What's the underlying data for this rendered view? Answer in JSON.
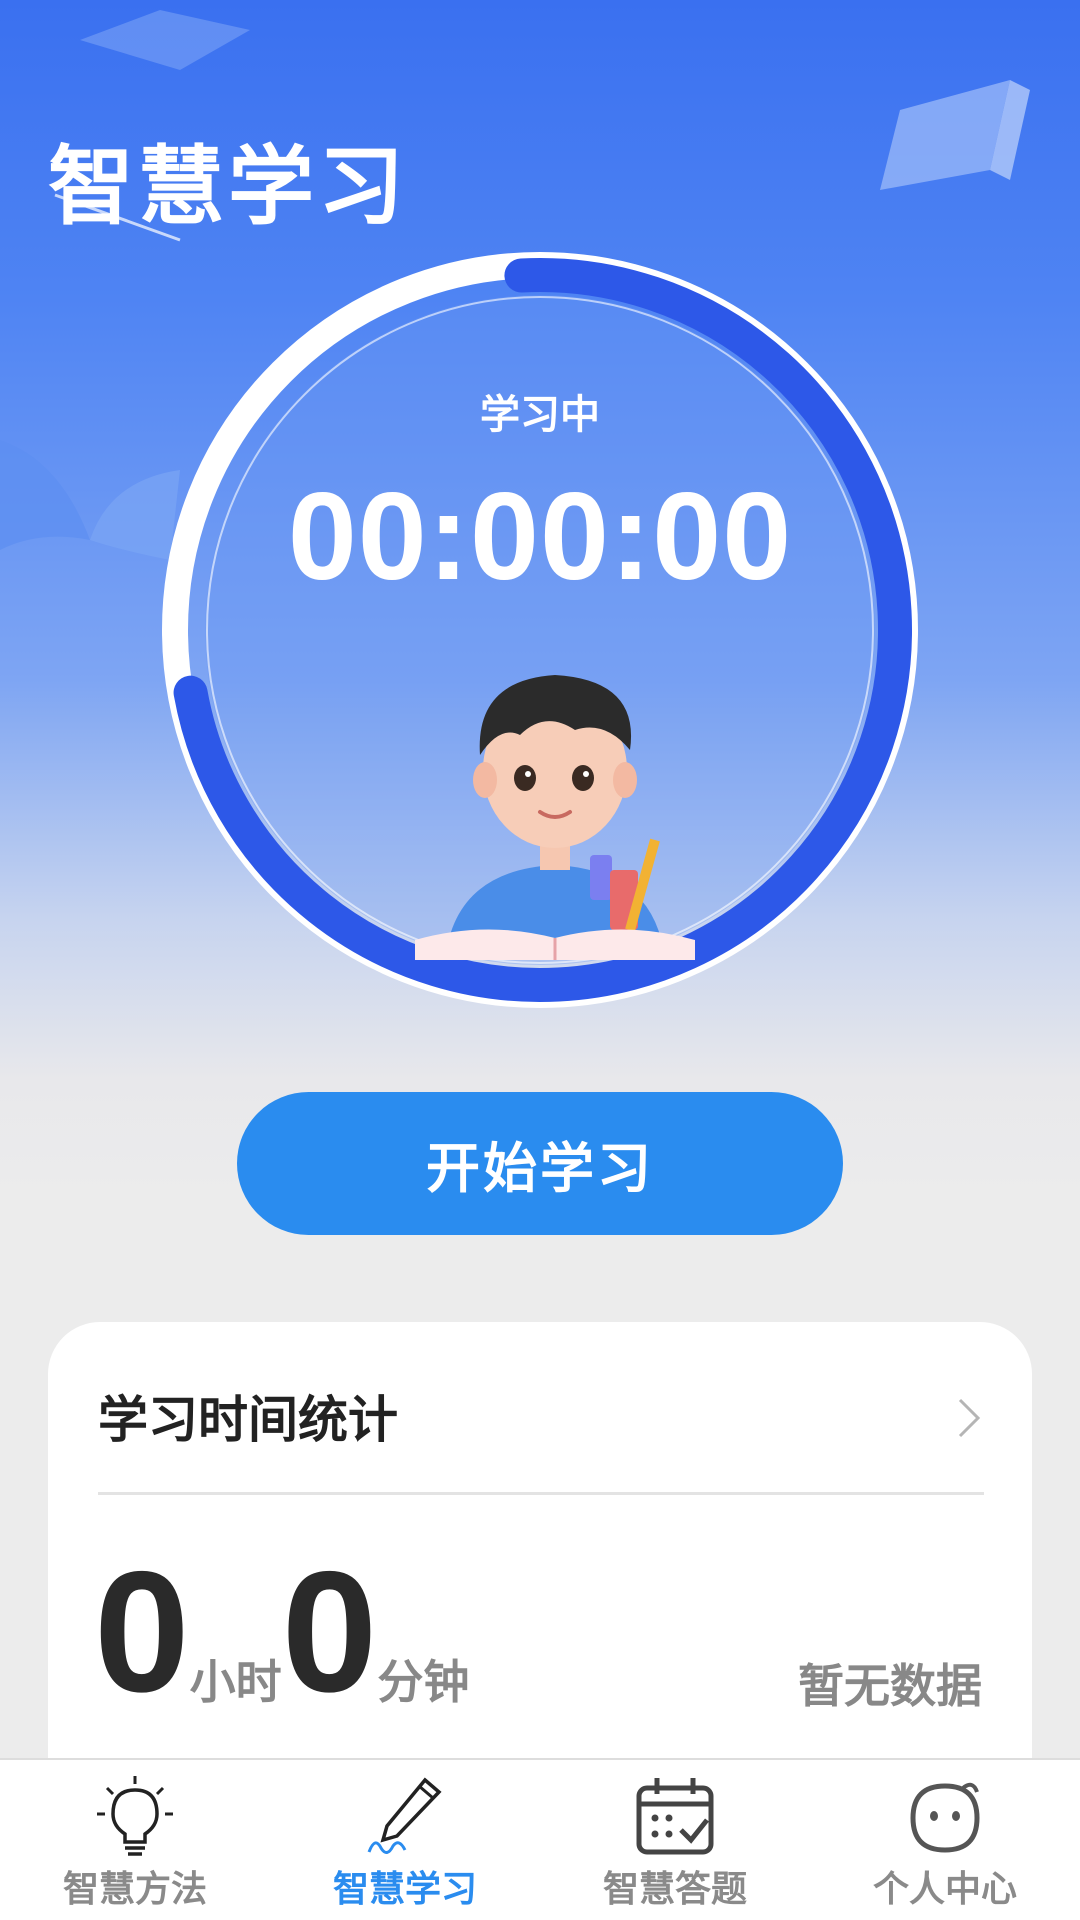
{
  "header": {
    "title": "智慧学习"
  },
  "timer": {
    "status": "学习中",
    "value": "00:00:00",
    "progress_fraction": 0.73,
    "ring_color": "#2d58e8"
  },
  "actions": {
    "start_label": "开始学习",
    "button_color": "#2a8cef"
  },
  "stats": {
    "title": "学习时间统计",
    "hours": "0",
    "hours_unit": "小时",
    "minutes": "0",
    "minutes_unit": "分钟",
    "empty_text": "暂无数据"
  },
  "tabs": [
    {
      "label": "智慧方法",
      "icon": "lightbulb-icon",
      "active": false
    },
    {
      "label": "智慧学习",
      "icon": "pen-icon",
      "active": true
    },
    {
      "label": "智慧答题",
      "icon": "calendar-check-icon",
      "active": false
    },
    {
      "label": "个人中心",
      "icon": "face-icon",
      "active": false
    }
  ],
  "colors": {
    "accent": "#2a8cef",
    "text_dark": "#222222",
    "text_muted": "#888888"
  }
}
